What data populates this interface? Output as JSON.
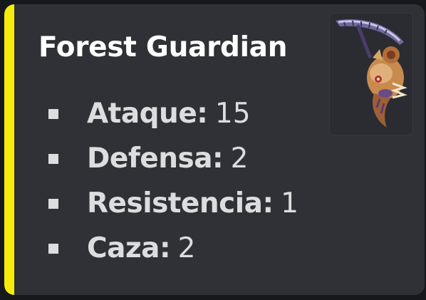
{
  "embed": {
    "accent_color": "#f5ec0c",
    "title": "Forest Guardian",
    "thumbnail_icon": "scythe-creature-icon",
    "stats": [
      {
        "label": "Ataque",
        "value": "15"
      },
      {
        "label": "Defensa",
        "value": "2"
      },
      {
        "label": "Resistencia",
        "value": "1"
      },
      {
        "label": "Caza",
        "value": "2"
      }
    ]
  }
}
